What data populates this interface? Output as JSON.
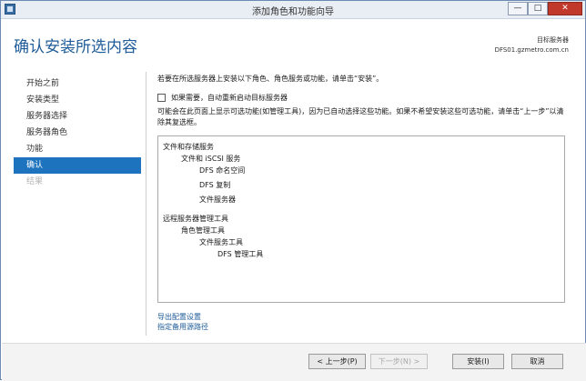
{
  "window": {
    "title": "添加角色和功能向导",
    "minimize_glyph": "—",
    "maximize_glyph": "□",
    "close_glyph": "✕"
  },
  "header": {
    "page_title": "确认安装所选内容",
    "target_label": "目标服务器",
    "target_server": "DFS01.gzmetro.com.cn"
  },
  "nav": {
    "items": [
      {
        "label": "开始之前",
        "state": "normal"
      },
      {
        "label": "安装类型",
        "state": "normal"
      },
      {
        "label": "服务器选择",
        "state": "normal"
      },
      {
        "label": "服务器角色",
        "state": "normal"
      },
      {
        "label": "功能",
        "state": "normal"
      },
      {
        "label": "确认",
        "state": "active"
      },
      {
        "label": "结果",
        "state": "disabled"
      }
    ]
  },
  "content": {
    "intro": "若要在所选服务器上安装以下角色、角色服务或功能，请单击“安装”。",
    "restart_label": "如果需要，自动重新启动目标服务器",
    "restart_checked": false,
    "note": "可能会在此页面上显示可选功能(如管理工具)，因为已自动选择这些功能。如果不希望安装这些可选功能，请单击“上一步”以清除其复选框。",
    "features": [
      {
        "label": "文件和存储服务"
      },
      {
        "label": "文件和 iSCSI 服务"
      },
      {
        "label": "DFS 命名空间"
      },
      {
        "label": "DFS 复制"
      },
      {
        "label": "文件服务器"
      },
      {
        "label": "远程服务器管理工具"
      },
      {
        "label": "角色管理工具"
      },
      {
        "label": "文件服务工具"
      },
      {
        "label": "DFS 管理工具"
      }
    ],
    "export_link": "导出配置设置",
    "alt_source_link": "指定备用源路径"
  },
  "footer": {
    "prev": "< 上一步(P)",
    "next": "下一步(N) >",
    "install": "安装(I)",
    "cancel": "取消"
  }
}
